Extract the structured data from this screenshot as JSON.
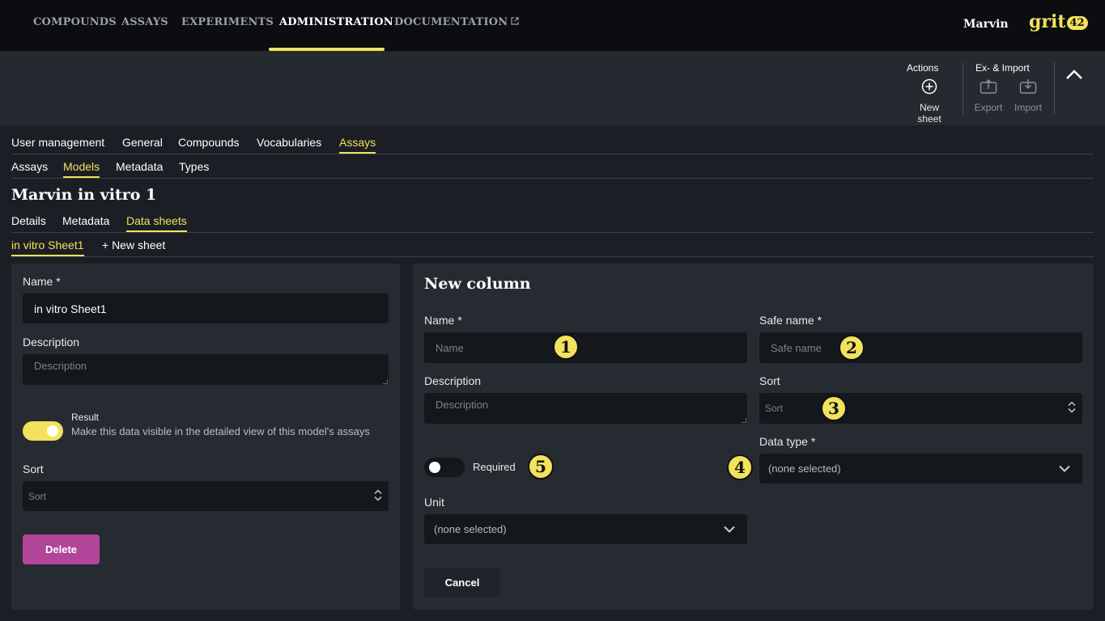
{
  "topnav": {
    "items": [
      "COMPOUNDS",
      "ASSAYS",
      "EXPERIMENTS",
      "ADMINISTRATION",
      "DOCUMENTATION"
    ],
    "active": "ADMINISTRATION",
    "user": "Marvin",
    "logo_text": "grit",
    "logo_badge": "42",
    "accent_color": "#f2e25c"
  },
  "toolbar": {
    "actions_label": "Actions",
    "new_sheet_label": "New sheet",
    "eximport_label": "Ex- & Import",
    "export_label": "Export",
    "import_label": "Import"
  },
  "admin_tabs": [
    "User management",
    "General",
    "Compounds",
    "Vocabularies",
    "Assays"
  ],
  "assay_tabs": [
    "Assays",
    "Models",
    "Metadata",
    "Types"
  ],
  "page_title": "Marvin in vitro 1",
  "model_tabs": [
    "Details",
    "Metadata",
    "Data sheets"
  ],
  "sheet_tabs": [
    "in vitro Sheet1",
    "+ New sheet"
  ],
  "sheet_form": {
    "name_label": "Name *",
    "name_value": "in vitro Sheet1",
    "description_label": "Description",
    "description_placeholder": "Description",
    "result_label": "Result",
    "result_help": "Make this data visible in the detailed view of this model's assays",
    "sort_label": "Sort",
    "sort_placeholder": "Sort",
    "delete_label": "Delete"
  },
  "column_form": {
    "title": "New column",
    "name_label": "Name *",
    "name_placeholder": "Name",
    "safe_name_label": "Safe name *",
    "safe_name_placeholder": "Safe name",
    "description_label": "Description",
    "description_placeholder": "Description",
    "sort_label": "Sort",
    "sort_placeholder": "Sort",
    "required_label": "Required",
    "data_type_label": "Data type *",
    "data_type_value": "(none selected)",
    "unit_label": "Unit",
    "unit_value": "(none selected)",
    "cancel_label": "Cancel"
  },
  "badges": [
    "1",
    "2",
    "3",
    "4",
    "5"
  ]
}
